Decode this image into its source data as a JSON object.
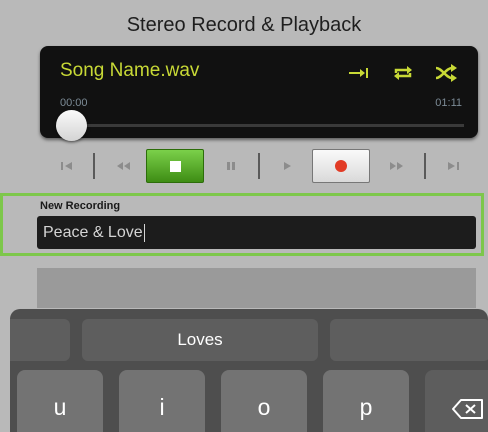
{
  "header": {
    "title": "Stereo Record & Playback"
  },
  "player": {
    "song_name": "Song Name.wav",
    "time_elapsed": "00:00",
    "time_total": "01:11",
    "progress": 0,
    "icons": [
      "skip-to-end-icon",
      "repeat-icon",
      "shuffle-icon"
    ],
    "colors": {
      "song_text": "#c8d936",
      "time_text": "#7c8b96"
    }
  },
  "transport": {
    "buttons": [
      "skip-back-icon",
      "rewind-icon",
      "stop-icon",
      "pause-icon",
      "play-icon",
      "record-icon",
      "fast-forward-icon",
      "skip-forward-icon"
    ],
    "active": [
      "stop",
      "record"
    ],
    "colors": {
      "stop_active": "#4fa823",
      "record_dot": "#e23b25"
    }
  },
  "new_recording": {
    "label": "New Recording",
    "value": "Peace & Love"
  },
  "highlight_color": "#7dc74b",
  "keyboard": {
    "suggestion": "Loves",
    "keys": [
      "u",
      "i",
      "o",
      "p"
    ],
    "delete_icon": "backspace-icon"
  }
}
